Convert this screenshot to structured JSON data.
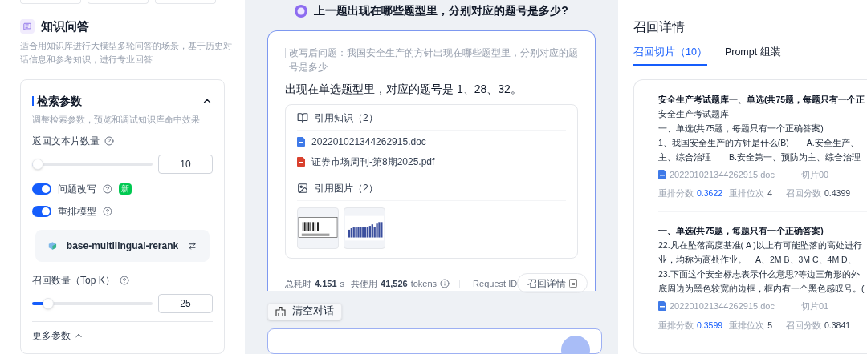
{
  "app": {
    "title": "知识问答",
    "description": "适合用知识库进行大模型多轮问答的场景，基于历史对话信息和参考知识，进行专业回答"
  },
  "retrieval": {
    "title": "检索参数",
    "expanded": true,
    "subtitle": "调整检索参数，预览和调试知识库命中效果",
    "params": [
      {
        "kind": "slider",
        "label": "返回文本片数量",
        "level": 0.03,
        "value": "10"
      },
      {
        "kind": "toggle",
        "label": "问题改写",
        "on": true,
        "badge": "新"
      },
      {
        "kind": "toggle",
        "label": "重排模型",
        "on": true
      },
      {
        "kind": "model",
        "name": "base-multilingual-rerank"
      },
      {
        "kind": "slider",
        "label": "召回数量（Top K）",
        "level": 0.12,
        "value": "25"
      }
    ],
    "more": {
      "label": "更多参数",
      "expanded": true
    }
  },
  "chat": {
    "question": "上一题出现在哪些题型里，分别对应的题号是多少?",
    "rewritten": "改写后问题：我国安全生产的方针出现在哪些题型里，分别对应的题号是多少",
    "answer": "出现在单选题型里，对应的题号是 1、28、32。",
    "knowledge": {
      "title": "引用知识（2）",
      "files": [
        {
          "kind": "doc",
          "name": "202201021344262915.doc"
        },
        {
          "kind": "pdf",
          "name": "证券市场周刊-第8期2025.pdf"
        }
      ]
    },
    "images": {
      "title": "引用图片（2）"
    },
    "stats": {
      "time_label": "总耗时",
      "time": "4.151",
      "time_unit": "s",
      "usage_label": "共使用",
      "tokens": "41,526",
      "tokens_unit": "tokens",
      "request_id": "Request ID",
      "detail_button": "召回详情"
    },
    "clear_button": "清空对话"
  },
  "recall": {
    "title": "召回详情",
    "tabs": [
      {
        "label": "召回切片（10）",
        "selected": true
      },
      {
        "label": "Prompt 组装",
        "selected": false
      }
    ],
    "chunks": [
      {
        "title": "安全生产考试题库一、单选(共75题，每题只有一个正",
        "lines": [
          "安全生产考试题库",
          "一、单选(共75题，每题只有一个正确答案)",
          "1、我国安全生产的方针是什么(B)　　A.安全生产、",
          "主、综合治理　　B.安全第一、预防为主、综合治理"
        ],
        "file": "202201021344262915.doc",
        "chunk": "切片00",
        "metrics": [
          {
            "label": "重排分数",
            "value": "0.3622",
            "highlight": true
          },
          {
            "label": "重排位次",
            "value": "4",
            "highlight": false
          },
          {
            "label": "召回分数",
            "value": "0.4399",
            "highlight": false
          }
        ]
      },
      {
        "title": "一、单选(共75题，每题只有一个正确答案)",
        "lines": [
          "22.凡在坠落高度基准( A )以上有可能坠落的高处进行",
          "业，均称为高处作业。　A、2M B、3M C、4M D、",
          "23.下面这个安全标志表示什么意思?等边三角形的外",
          "底周边为黑色较宽的边框，框内有一个黑色感叹号。("
        ],
        "file": "202201021344262915.doc",
        "chunk": "切片01",
        "metrics": [
          {
            "label": "重排分数",
            "value": "0.3599",
            "highlight": true
          },
          {
            "label": "重排位次",
            "value": "5",
            "highlight": false
          },
          {
            "label": "召回分数",
            "value": "0.3841",
            "highlight": false
          }
        ]
      }
    ]
  }
}
